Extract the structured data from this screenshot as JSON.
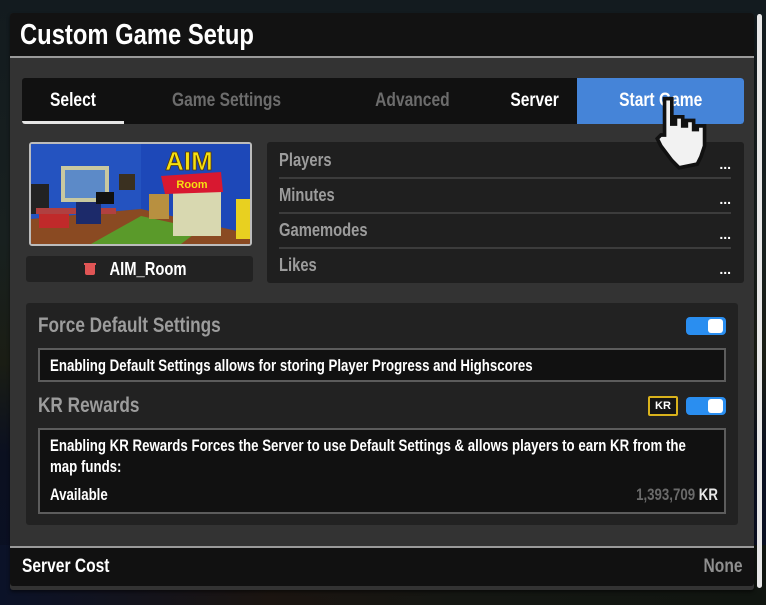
{
  "window": {
    "title": "Custom Game Setup"
  },
  "tabs": [
    {
      "label": "Select",
      "state": "active"
    },
    {
      "label": "Game Settings",
      "state": "disabled"
    },
    {
      "label": "Advanced",
      "state": "disabled"
    },
    {
      "label": "Server",
      "state": "normal"
    },
    {
      "label": "Start Game",
      "state": "primary"
    }
  ],
  "map": {
    "name": "AIM_Room",
    "thumbnail_title": "AIM",
    "thumbnail_subtitle": "Room",
    "icon": "trash-icon"
  },
  "stats": [
    {
      "label": "Players",
      "value": "..."
    },
    {
      "label": "Minutes",
      "value": "..."
    },
    {
      "label": "Gamemodes",
      "value": "..."
    },
    {
      "label": "Likes",
      "value": "..."
    }
  ],
  "settings": {
    "force_default": {
      "title": "Force Default Settings",
      "enabled": true,
      "description": "Enabling Default Settings allows for storing Player Progress and Highscores"
    },
    "kr_rewards": {
      "title": "KR Rewards",
      "badge": "KR",
      "enabled": true,
      "description": "Enabling KR Rewards Forces the Server to use Default Settings & allows players to earn KR from the map funds:",
      "available_label": "Available",
      "available_amount": "1,393,709",
      "available_currency": "KR"
    }
  },
  "footer": {
    "label": "Server Cost",
    "value": "None"
  },
  "colors": {
    "accent": "#4584d8",
    "toggle_on": "#2a8ef0",
    "kr_badge_border": "#d9b21c",
    "trash": "#e05555"
  }
}
